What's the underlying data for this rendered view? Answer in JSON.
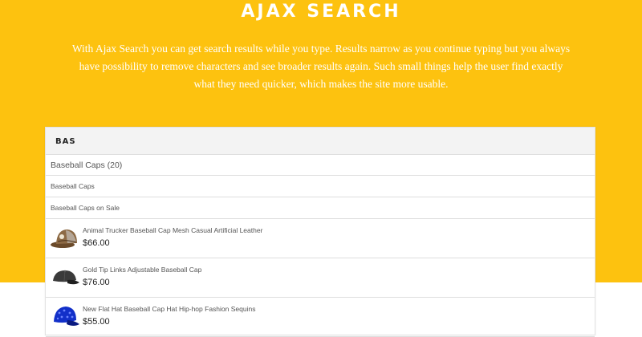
{
  "hero": {
    "title": "AJAX SEARCH",
    "description": "With Ajax Search you can get search results while you type. Results narrow as you continue typing but you always have possibility to remove characters and see broader results again. Such small things help the user find exactly what they need quicker, which makes the site more usable."
  },
  "search": {
    "value": "BAS"
  },
  "results": {
    "category_header": "Baseball Caps (20)",
    "categories": [
      {
        "label": "Baseball Caps"
      },
      {
        "label": "Baseball Caps on Sale"
      }
    ],
    "products": [
      {
        "name": "Animal Trucker Baseball Cap Mesh Casual Artificial Leather",
        "price": "$66.00",
        "icon": "brown-trucker-cap"
      },
      {
        "name": "Gold Tip Links Adjustable Baseball Cap",
        "price": "$76.00",
        "icon": "black-baseball-cap"
      },
      {
        "name": "New Flat Hat Baseball Cap Hat Hip-hop Fashion Sequins",
        "price": "$55.00",
        "icon": "blue-sequin-cap"
      }
    ]
  },
  "colors": {
    "hero_background": "#FDC20F",
    "text_on_hero": "#FFFFFF"
  }
}
